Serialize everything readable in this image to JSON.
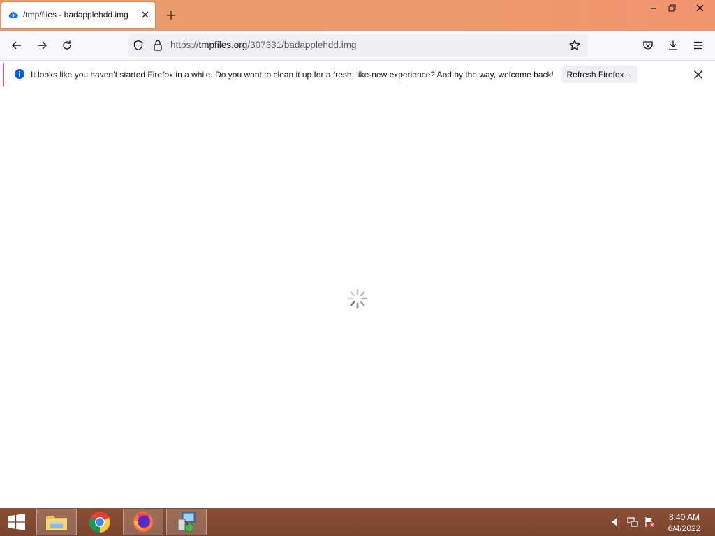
{
  "browser": {
    "tab": {
      "title": "/tmp/files - badapplehdd.img"
    },
    "window_controls": {
      "minimize": "minimize",
      "restore": "restore",
      "close": "close"
    }
  },
  "navbar": {
    "url_prefix": "https://",
    "url_host": "tmpfiles.org",
    "url_path": "/307331/badapplehdd.img"
  },
  "notification": {
    "message": "It looks like you haven’t started Firefox in a while. Do you want to clean it up for a fresh, like-new experience? And by the way, welcome back!",
    "button_label": "Refresh Firefox…"
  },
  "taskbar": {
    "clock_time": "8:40 AM",
    "clock_date": "6/4/2022"
  },
  "colors": {
    "tabstrip": "#ec9a6e",
    "taskbar": "#7a4430",
    "info_blue": "#0060df"
  }
}
